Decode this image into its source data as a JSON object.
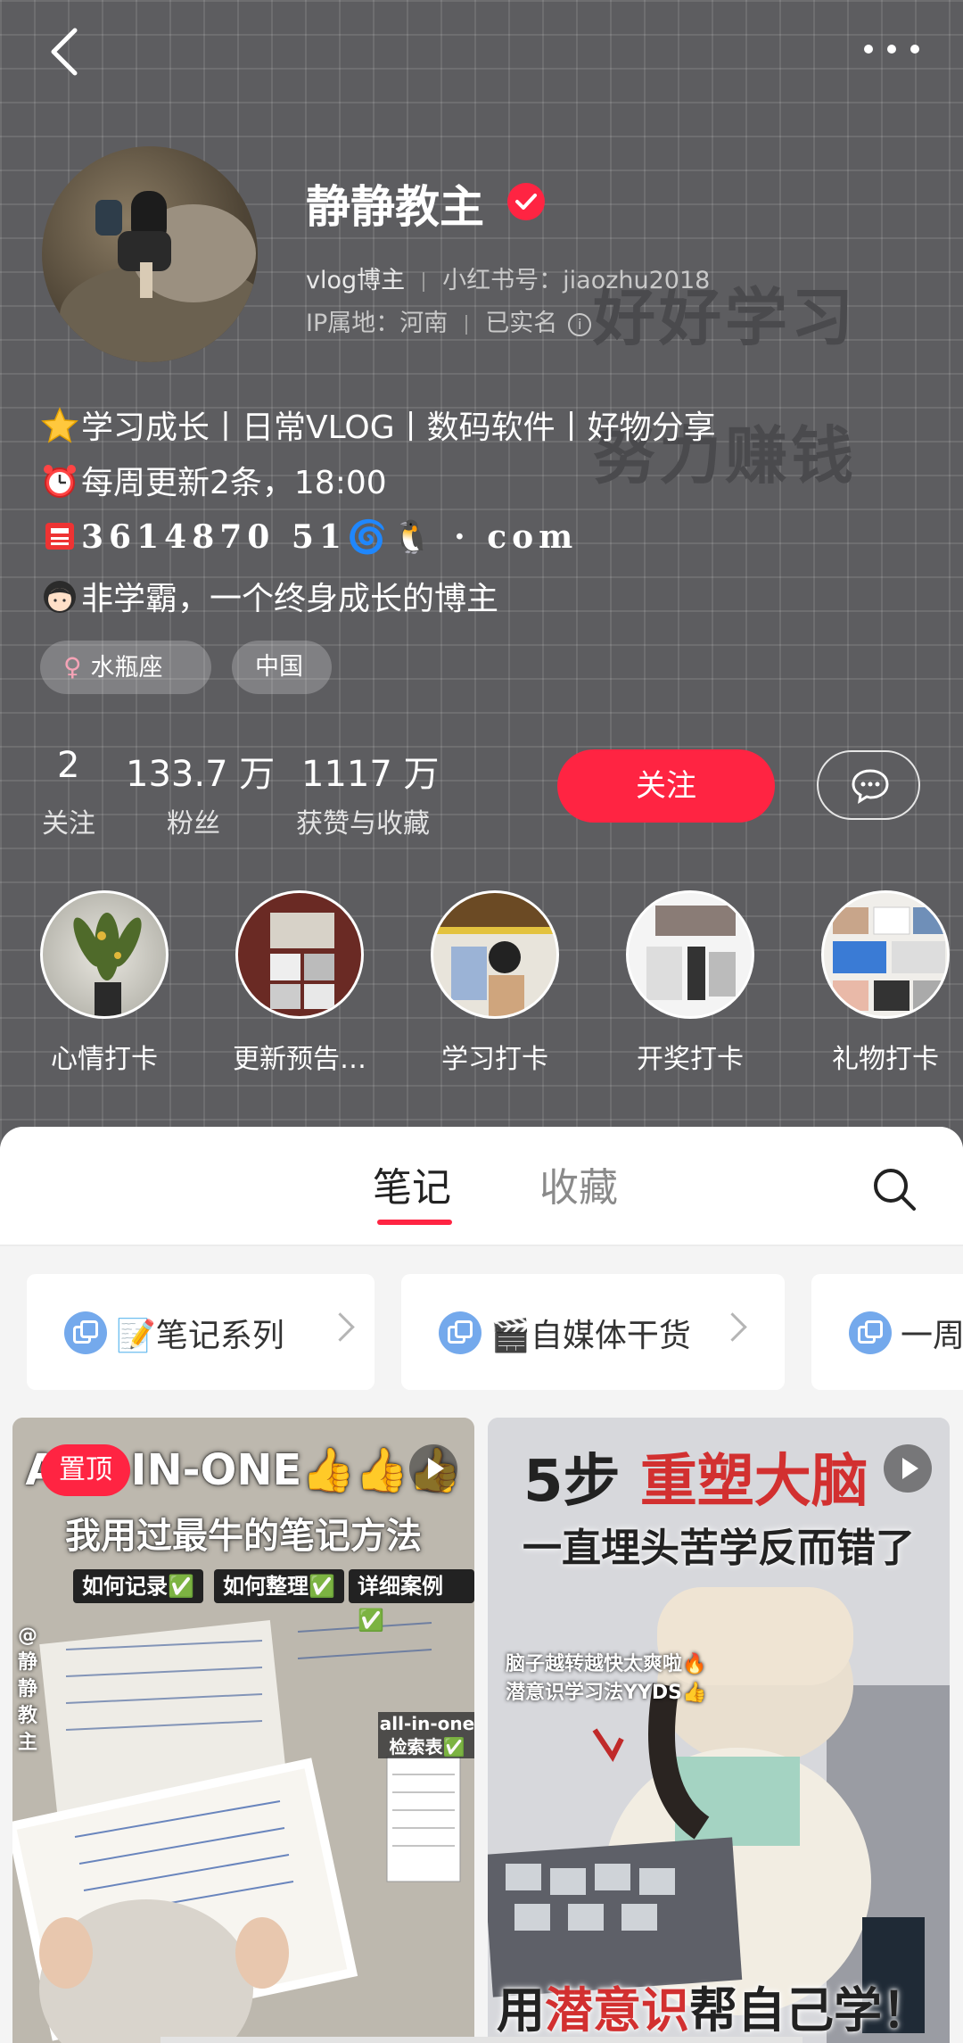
{
  "header": {
    "back_icon": "chevron-left-icon",
    "more_icon": "more-dots-icon",
    "decor_text_1": "好好学习",
    "decor_text_2": "努力赚钱"
  },
  "profile": {
    "name": "静静教主",
    "verified_icon": "verified-check-icon",
    "category": "vlog博主",
    "xhs_id": "小红书号：jiaozhu2018",
    "ip_location": "IP属地：河南",
    "real_name": "已实名",
    "bio": [
      {
        "emoji": "star",
        "text": "学习成长丨日常VLOG丨数码软件丨好物分享"
      },
      {
        "emoji": "alarm-clock",
        "text": "每周更新2条，18:00"
      },
      {
        "emoji": "mailbox",
        "text": "3614870 51🌀🐧 · com"
      },
      {
        "emoji": "girl",
        "text": "非学霸，一个终身成长的博主"
      }
    ],
    "tags": [
      "水瓶座",
      "中国"
    ],
    "stats": [
      {
        "value": "2",
        "label": "关注"
      },
      {
        "value": "133.7 万",
        "label": "粉丝"
      },
      {
        "value": "1117 万",
        "label": "获赞与收藏"
      }
    ],
    "follow_label": "关注",
    "message_icon": "chat-bubble-icon"
  },
  "highlights": [
    "心情打卡",
    "更新预告…",
    "学习打卡",
    "开奖打卡",
    "礼物打卡"
  ],
  "tabs": {
    "notes": "笔记",
    "favorites": "收藏",
    "search_icon": "search-icon"
  },
  "collections": [
    {
      "emoji": "📝",
      "label": "笔记系列"
    },
    {
      "emoji": "🎬",
      "label": "自媒体干货"
    },
    {
      "emoji": "",
      "label": "一周"
    }
  ],
  "cards": [
    {
      "pin": "置顶",
      "title_1": "ALL-IN-ONE👍👍👍",
      "title_2": "我用过最牛的笔记方法",
      "subs": [
        "如何记录✅",
        "如何整理✅",
        "详细案例✅"
      ],
      "side_text": "@静静教主",
      "index_label": "all-in-one 检索表✅"
    },
    {
      "title_a": "5步",
      "title_b": "重塑大脑",
      "subtitle": "一直埋头苦学反而错了",
      "small_1": "脑子越转越快太爽啦🔥",
      "small_2": "潜意识学习法YYDS👍",
      "bottom_a": "用",
      "bottom_b": "潜意识",
      "bottom_c": "帮自己学！"
    }
  ]
}
